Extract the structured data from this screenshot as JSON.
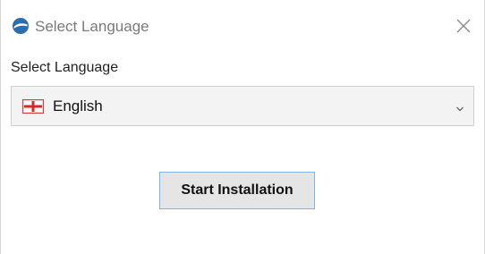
{
  "window": {
    "title": "Select Language",
    "app_icon": "app-logo-icon",
    "close_icon": "close-icon"
  },
  "language_section": {
    "label": "Select Language",
    "selected_value": "English",
    "flag_icon": "flag-icon",
    "dropdown_icon": "chevron-down-icon"
  },
  "actions": {
    "start_label": "Start Installation"
  },
  "colors": {
    "accent_border": "#7eb4ea",
    "app_icon": "#2a6db0",
    "button_bg": "#e5e5e5",
    "select_bg": "#f3f3f3"
  }
}
